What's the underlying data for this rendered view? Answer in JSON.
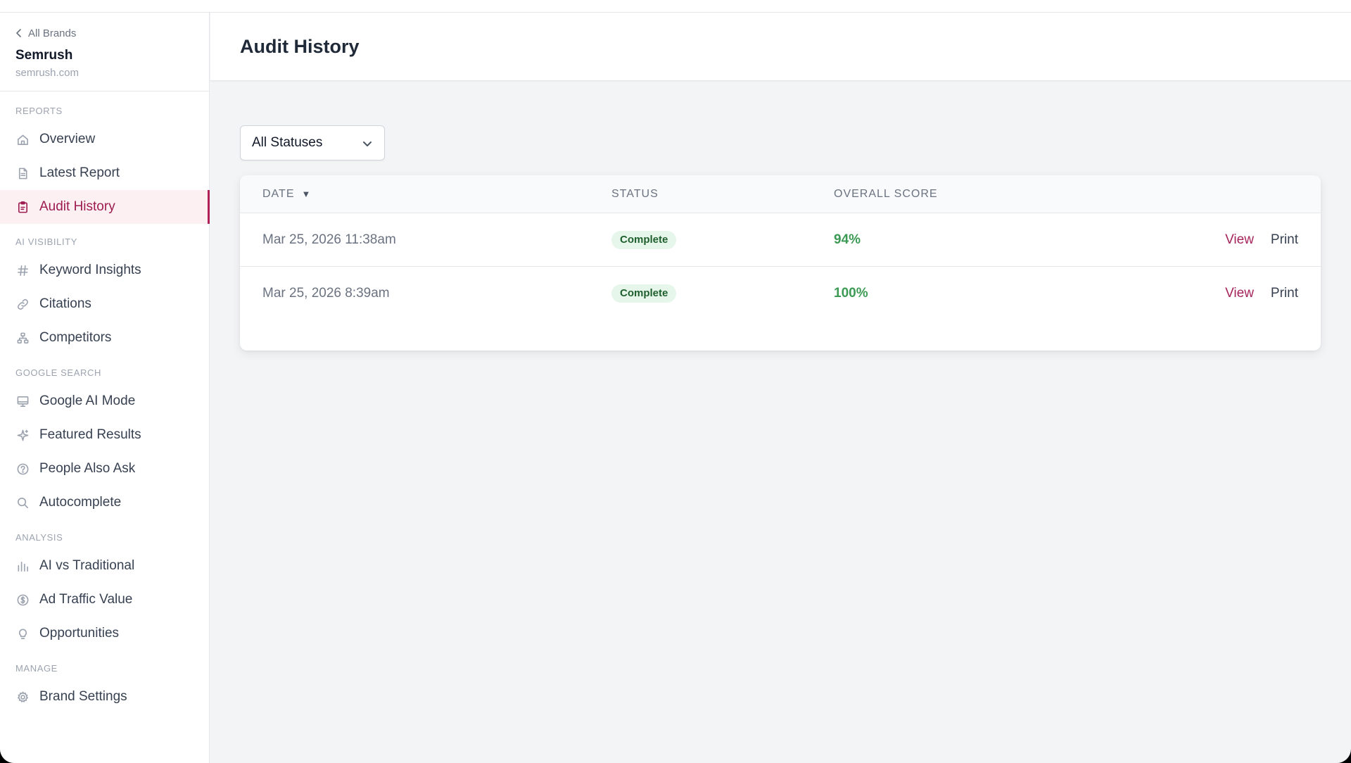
{
  "brand": {
    "back_label": "All Brands",
    "name": "Semrush",
    "domain": "semrush.com"
  },
  "sidebar": {
    "sections": [
      {
        "label": "REPORTS",
        "items": [
          {
            "label": "Overview",
            "icon": "home-icon"
          },
          {
            "label": "Latest Report",
            "icon": "document-icon"
          },
          {
            "label": "Audit History",
            "icon": "clipboard-icon",
            "active": true
          }
        ]
      },
      {
        "label": "AI VISIBILITY",
        "items": [
          {
            "label": "Keyword Insights",
            "icon": "hash-icon"
          },
          {
            "label": "Citations",
            "icon": "link-icon"
          },
          {
            "label": "Competitors",
            "icon": "hierarchy-icon"
          }
        ]
      },
      {
        "label": "GOOGLE SEARCH",
        "items": [
          {
            "label": "Google AI Mode",
            "icon": "monitor-icon"
          },
          {
            "label": "Featured Results",
            "icon": "sparkle-icon"
          },
          {
            "label": "People Also Ask",
            "icon": "question-circle-icon"
          },
          {
            "label": "Autocomplete",
            "icon": "search-icon"
          }
        ]
      },
      {
        "label": "ANALYSIS",
        "items": [
          {
            "label": "AI vs Traditional",
            "icon": "bar-chart-icon"
          },
          {
            "label": "Ad Traffic Value",
            "icon": "dollar-circle-icon"
          },
          {
            "label": "Opportunities",
            "icon": "lightbulb-icon"
          }
        ]
      },
      {
        "label": "MANAGE",
        "items": [
          {
            "label": "Brand Settings",
            "icon": "gear-icon"
          }
        ]
      }
    ]
  },
  "page": {
    "title": "Audit History",
    "filter": {
      "selected": "All Statuses"
    }
  },
  "table": {
    "headers": {
      "date": "DATE",
      "status": "STATUS",
      "score": "OVERALL SCORE"
    },
    "sort_indicator": "▼",
    "rows": [
      {
        "date": "Mar 25, 2026 11:38am",
        "status": "Complete",
        "score": "94%",
        "view": "View",
        "print": "Print"
      },
      {
        "date": "Mar 25, 2026 8:39am",
        "status": "Complete",
        "score": "100%",
        "view": "View",
        "print": "Print"
      }
    ]
  },
  "colors": {
    "accent": "#a4245b",
    "active_bg": "#fdf0f3",
    "score_green": "#3d9a55",
    "badge_bg": "#e6f6ea"
  }
}
